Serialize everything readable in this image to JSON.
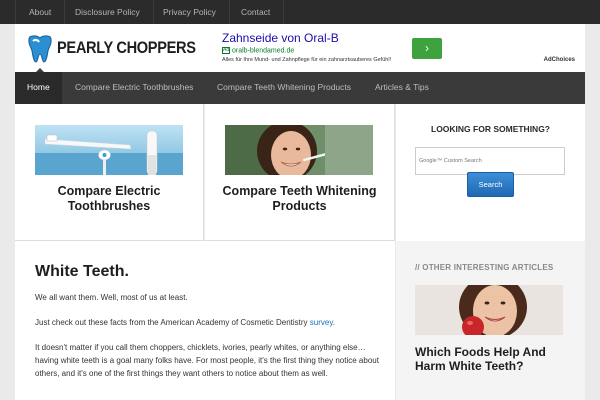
{
  "topnav": {
    "items": [
      {
        "label": "About"
      },
      {
        "label": "Disclosure Policy"
      },
      {
        "label": "Privacy Policy"
      },
      {
        "label": "Contact"
      }
    ]
  },
  "header": {
    "logo_text": "PEARLY CHOPPERS"
  },
  "ad": {
    "title": "Zahnseide von Oral-B",
    "url": "oralb-blendamed.de",
    "description": "Alles für Ihre Mund- und Zahnpflege für ein zahnarztsauberes Gefühl!",
    "button_glyph": "›",
    "choices": "AdChoices",
    "badge": "Ad"
  },
  "mainnav": {
    "items": [
      {
        "label": "Home"
      },
      {
        "label": "Compare Electric Toothbrushes"
      },
      {
        "label": "Compare Teeth Whitening Products"
      },
      {
        "label": "Articles & Tips"
      }
    ]
  },
  "features": [
    {
      "title": "Compare Electric Toothbrushes"
    },
    {
      "title": "Compare Teeth Whitening Products"
    }
  ],
  "search": {
    "heading": "LOOKING FOR SOMETHING?",
    "placeholder": "Google™ Custom Search",
    "button_label": "Search"
  },
  "post": {
    "title": "White Teeth.",
    "p1": "We all want them. Well, most of us at least.",
    "p2_before": "Just check out these facts from the American Academy of Cosmetic Dentistry ",
    "p2_link": "survey",
    "p2_after": ".",
    "p3": "It doesn't matter if you call them choppers, chicklets, ivories, pearly whites, or anything else…having white teeth is a goal many folks have. For most people, it's the first thing they notice about others, and it's one of the first things they want others to notice about them as well."
  },
  "sidebar": {
    "heading": "//  OTHER INTERESTING ARTICLES",
    "post_title": "Which Foods Help And Harm White Teeth?"
  },
  "colors": {
    "topbar": "#2b2b2b",
    "mainnav": "#3a3a3a",
    "link": "#1a6fbf",
    "search_button": "#1f68b3",
    "ad_button": "#3ea33e"
  }
}
